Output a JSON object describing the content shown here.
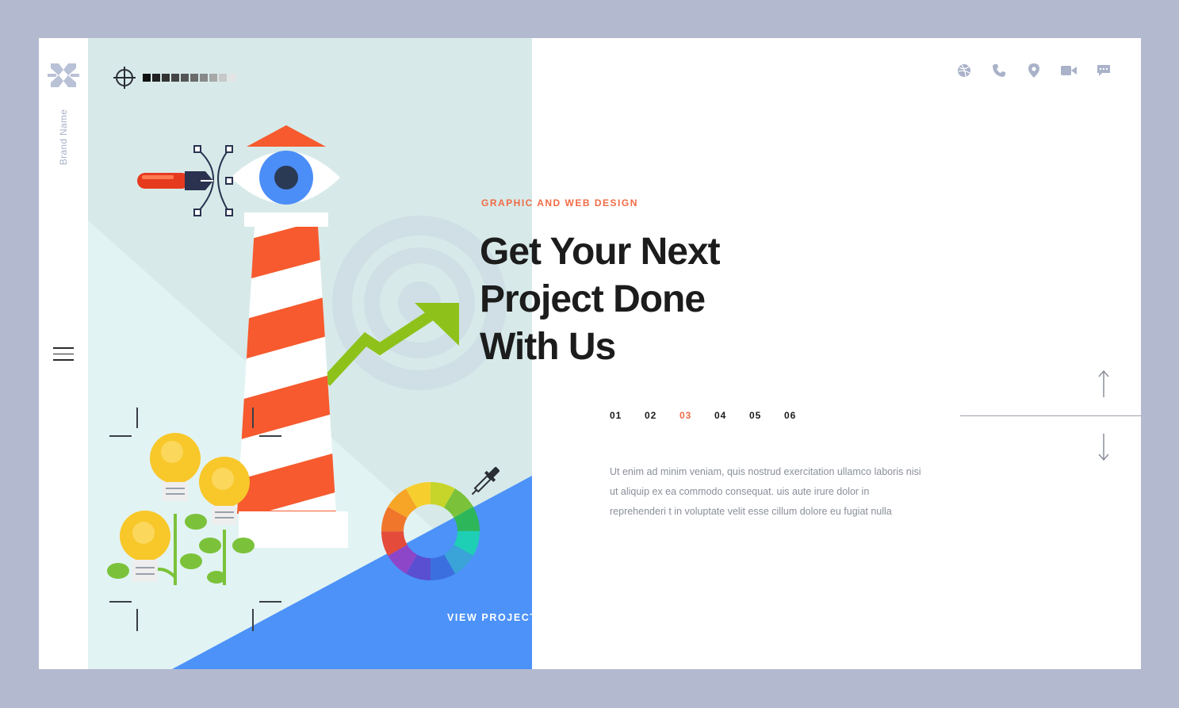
{
  "brand": {
    "name": "Brand Name",
    "logo_icon": "x-cross-logo-icon"
  },
  "palette": {
    "accent": "#f06b45",
    "blue": "#4c8ef7",
    "panel": "#d7eae9",
    "outer": "#b3b9cf"
  },
  "menu": {
    "icon": "hamburger-menu-icon"
  },
  "top_icons": [
    "dribbble-icon",
    "phone-icon",
    "location-pin-icon",
    "video-camera-icon",
    "chat-bubble-icon"
  ],
  "hero": {
    "eyebrow": "GRAPHIC AND WEB DESIGN",
    "headline_lines": [
      "Get Your Next",
      "Project Done",
      "With Us"
    ],
    "pager": [
      "01",
      "02",
      "03",
      "04",
      "05",
      "06"
    ],
    "active_page": "03",
    "body": "Ut enim ad minim veniam, quis nostrud exercitation ullamco laboris nisi ut aliquip ex ea commodo consequat. uis aute irure dolor in reprehenderi t in voluptate velit esse cillum dolore eu fugiat nulla",
    "cta": "VIEW PROJECT"
  },
  "nav_arrows": [
    "arrow-up-icon",
    "arrow-down-icon"
  ]
}
